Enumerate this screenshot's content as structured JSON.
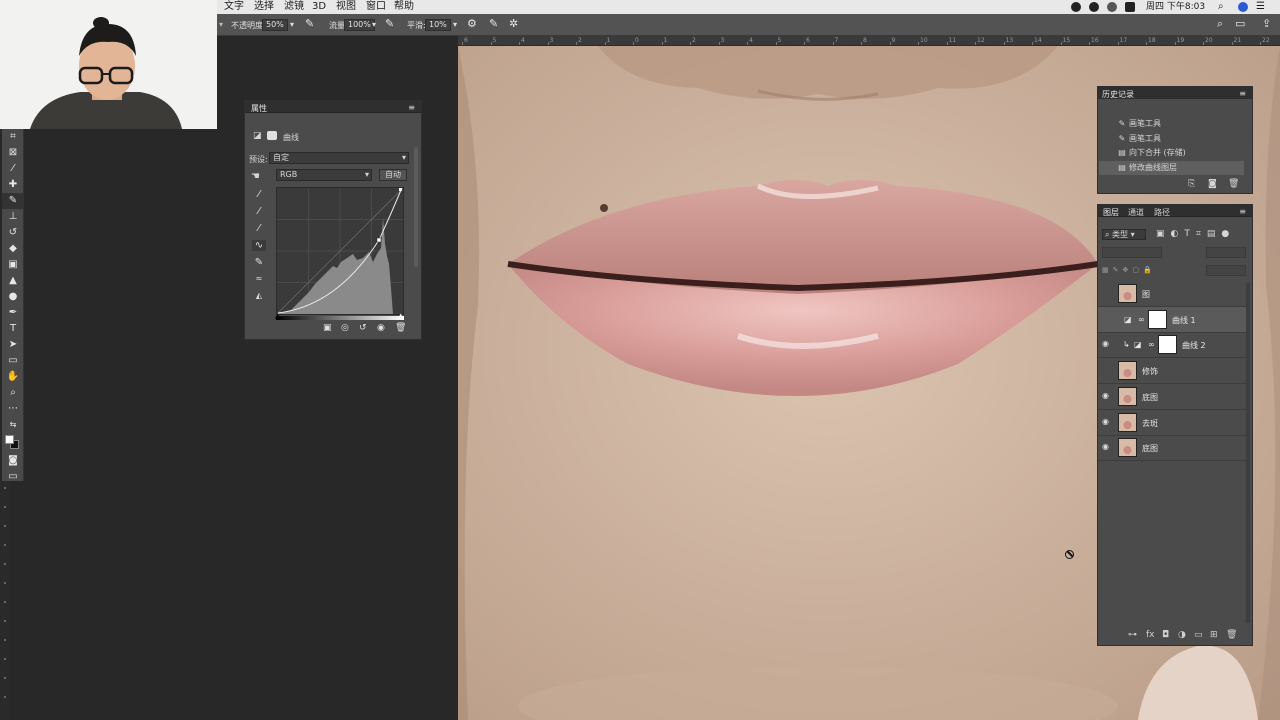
{
  "menubar": {
    "items": [
      "文字",
      "选择",
      "滤镜",
      "3D",
      "视图",
      "窗口",
      "帮助"
    ],
    "clock": "周四 下午8:03"
  },
  "options_bar": {
    "opacity_label": "不透明度:",
    "opacity_value": "50%",
    "flow_label": "流量:",
    "flow_value": "100%",
    "smoothing_label": "平滑:",
    "smoothing_value": "10%"
  },
  "ruler": {
    "labels": [
      "6",
      "5",
      "4",
      "3",
      "2",
      "1",
      "0",
      "1",
      "2",
      "3",
      "4",
      "5",
      "6",
      "7",
      "8",
      "9",
      "10",
      "11",
      "12",
      "13",
      "14",
      "15",
      "16",
      "17",
      "18",
      "19",
      "20",
      "21",
      "22"
    ]
  },
  "properties": {
    "tab": "属性",
    "type_label": "曲线",
    "preset_label": "预设:",
    "preset_value": "自定",
    "channel_value": "RGB",
    "auto_button": "自动"
  },
  "history": {
    "tab": "历史记录",
    "items": [
      {
        "label": "画笔工具",
        "icon": "brush-icon"
      },
      {
        "label": "画笔工具",
        "icon": "brush-icon"
      },
      {
        "label": "向下合并 (存储)",
        "icon": "layer-icon"
      },
      {
        "label": "修改曲线图层",
        "icon": "layer-icon"
      }
    ],
    "selected_index": 3
  },
  "layers_panel": {
    "tabs": [
      "图层",
      "通道",
      "路径"
    ],
    "kind_filter": "类型",
    "layers": [
      {
        "name": "图",
        "visible": false,
        "kind": "pixel",
        "selected": false
      },
      {
        "name": "曲线 1",
        "visible": false,
        "kind": "adjustment",
        "selected": true
      },
      {
        "name": "曲线 2",
        "visible": true,
        "kind": "adjustment",
        "selected": false,
        "clipped": true
      },
      {
        "name": "修饰",
        "visible": false,
        "kind": "pixel",
        "selected": false
      },
      {
        "name": "底图",
        "visible": true,
        "kind": "pixel",
        "selected": false
      },
      {
        "name": "去斑",
        "visible": true,
        "kind": "pixel",
        "selected": false
      },
      {
        "name": "底图",
        "visible": true,
        "kind": "pixel",
        "selected": false
      }
    ]
  },
  "colors": {
    "panel_bg": "#4b4b4b",
    "panel_header": "#2f2f2f",
    "selected_row": "#5a5a5a",
    "workspace": "#282828"
  }
}
